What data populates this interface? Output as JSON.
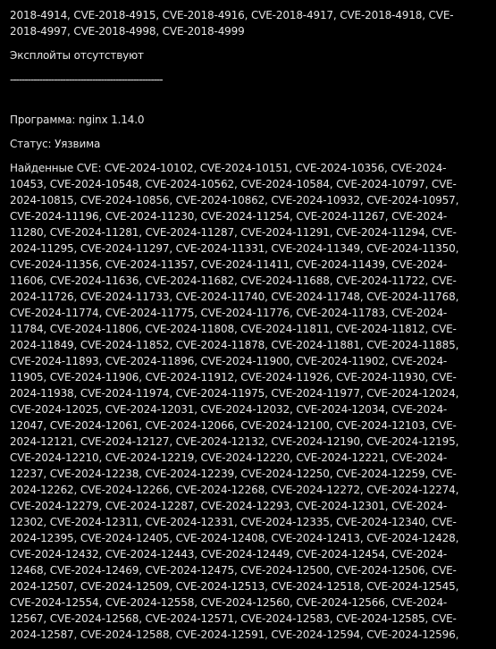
{
  "terminal": {
    "previous_cves": "2018-4914, CVE-2018-4915, CVE-2018-4916, CVE-2018-4917, CVE-2018-4918, CVE-2018-4997, CVE-2018-4998, CVE-2018-4999",
    "exploits_status": "Эксплойты отсутствуют",
    "separator": "----------------------------------------------------",
    "program_line": "Программа: nginx 1.14.0",
    "status_line": "Статус: Уязвима",
    "found_cves": "Найденные CVE: CVE-2024-10102, CVE-2024-10151, CVE-2024-10356, CVE-2024-10453, CVE-2024-10548, CVE-2024-10562, CVE-2024-10584, CVE-2024-10797, CVE-2024-10815, CVE-2024-10856, CVE-2024-10862, CVE-2024-10932, CVE-2024-10957, CVE-2024-11196, CVE-2024-11230, CVE-2024-11254, CVE-2024-11267, CVE-2024-11280, CVE-2024-11281, CVE-2024-11287, CVE-2024-11291, CVE-2024-11294, CVE-2024-11295, CVE-2024-11297, CVE-2024-11331, CVE-2024-11349, CVE-2024-11350, CVE-2024-11356, CVE-2024-11357, CVE-2024-11411, CVE-2024-11439, CVE-2024-11606, CVE-2024-11636, CVE-2024-11682, CVE-2024-11688, CVE-2024-11722, CVE-2024-11726, CVE-2024-11733, CVE-2024-11740, CVE-2024-11748, CVE-2024-11768, CVE-2024-11774, CVE-2024-11775, CVE-2024-11776, CVE-2024-11783, CVE-2024-11784, CVE-2024-11806, CVE-2024-11808, CVE-2024-11811, CVE-2024-11812, CVE-2024-11849, CVE-2024-11852, CVE-2024-11878, CVE-2024-11881, CVE-2024-11885, CVE-2024-11893, CVE-2024-11896, CVE-2024-11900, CVE-2024-11902, CVE-2024-11905, CVE-2024-11906, CVE-2024-11912, CVE-2024-11926, CVE-2024-11930, CVE-2024-11938, CVE-2024-11974, CVE-2024-11975, CVE-2024-11977, CVE-2024-12024, CVE-2024-12025, CVE-2024-12031, CVE-2024-12032, CVE-2024-12034, CVE-2024-12047, CVE-2024-12061, CVE-2024-12066, CVE-2024-12100, CVE-2024-12103, CVE-2024-12121, CVE-2024-12127, CVE-2024-12132, CVE-2024-12190, CVE-2024-12195, CVE-2024-12210, CVE-2024-12219, CVE-2024-12220, CVE-2024-12221, CVE-2024-12237, CVE-2024-12238, CVE-2024-12239, CVE-2024-12250, CVE-2024-12259, CVE-2024-12262, CVE-2024-12266, CVE-2024-12268, CVE-2024-12272, CVE-2024-12274, CVE-2024-12279, CVE-2024-12287, CVE-2024-12293, CVE-2024-12301, CVE-2024-12302, CVE-2024-12311, CVE-2024-12331, CVE-2024-12335, CVE-2024-12340, CVE-2024-12395, CVE-2024-12405, CVE-2024-12408, CVE-2024-12413, CVE-2024-12428, CVE-2024-12432, CVE-2024-12443, CVE-2024-12449, CVE-2024-12454, CVE-2024-12468, CVE-2024-12469, CVE-2024-12475, CVE-2024-12500, CVE-2024-12506, CVE-2024-12507, CVE-2024-12509, CVE-2024-12513, CVE-2024-12518, CVE-2024-12545, CVE-2024-12554, CVE-2024-12558, CVE-2024-12560, CVE-2024-12566, CVE-2024-12567, CVE-2024-12568, CVE-2024-12571, CVE-2024-12583, CVE-2024-12585, CVE-2024-12587, CVE-2024-12588, CVE-2024-12591, CVE-2024-12594, CVE-2024-12596,"
  },
  "colors": {
    "background": "#000000",
    "text": "#e6e6e6"
  }
}
